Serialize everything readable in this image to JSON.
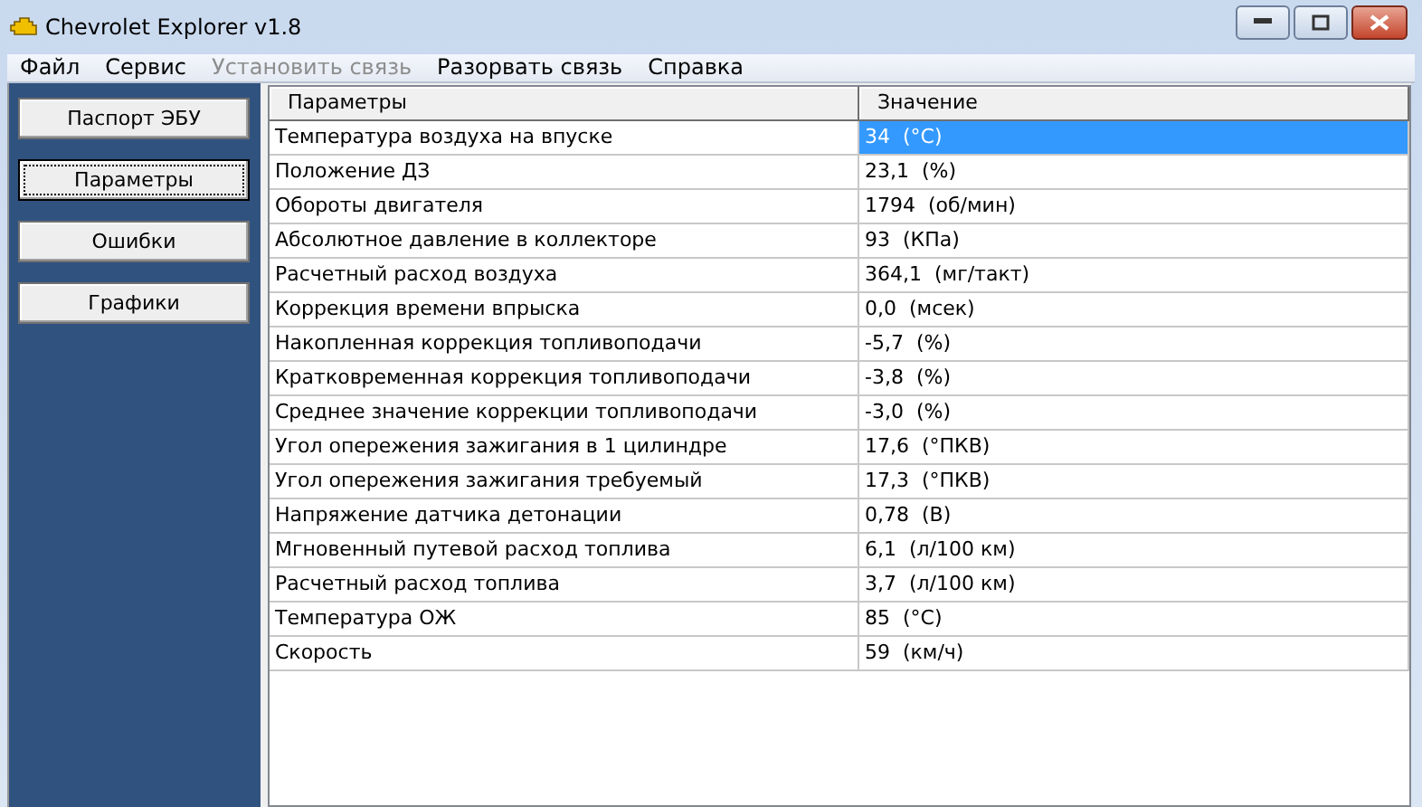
{
  "window": {
    "title": "Chevrolet Explorer v1.8"
  },
  "menu": [
    {
      "label": "Файл",
      "disabled": false
    },
    {
      "label": "Сервис",
      "disabled": false
    },
    {
      "label": "Установить связь",
      "disabled": true
    },
    {
      "label": "Разорвать связь",
      "disabled": false
    },
    {
      "label": "Справка",
      "disabled": false
    }
  ],
  "sidebar": {
    "buttons": [
      {
        "label": "Паспорт ЭБУ",
        "selected": false
      },
      {
        "label": "Параметры",
        "selected": true
      },
      {
        "label": "Ошибки",
        "selected": false
      },
      {
        "label": "Графики",
        "selected": false
      }
    ]
  },
  "table": {
    "columns": [
      "Параметры",
      "Значение"
    ],
    "rows": [
      {
        "name": "Температура воздуха на впуске",
        "value": "34  (°C)",
        "selected": true
      },
      {
        "name": "Положение ДЗ",
        "value": "23,1  (%)",
        "selected": false
      },
      {
        "name": "Обороты двигателя",
        "value": "1794  (об/мин)",
        "selected": false
      },
      {
        "name": "Абсолютное давление в коллекторе",
        "value": "93  (КПа)",
        "selected": false
      },
      {
        "name": "Расчетный расход воздуха",
        "value": "364,1  (мг/такт)",
        "selected": false
      },
      {
        "name": "Коррекция времени впрыска",
        "value": "0,0  (мсек)",
        "selected": false
      },
      {
        "name": "Накопленная коррекция топливоподачи",
        "value": "-5,7  (%)",
        "selected": false
      },
      {
        "name": "Кратковременная коррекция топливоподачи",
        "value": "-3,8  (%)",
        "selected": false
      },
      {
        "name": "Среднее значение коррекции топливоподачи",
        "value": "-3,0  (%)",
        "selected": false
      },
      {
        "name": "Угол опережения зажигания в 1 цилиндре",
        "value": "17,6  (°ПКВ)",
        "selected": false
      },
      {
        "name": "Угол опережения зажигания требуемый",
        "value": "17,3  (°ПКВ)",
        "selected": false
      },
      {
        "name": "Напряжение датчика детонации",
        "value": "0,78  (В)",
        "selected": false
      },
      {
        "name": "Мгновенный путевой расход топлива",
        "value": "6,1  (л/100 км)",
        "selected": false
      },
      {
        "name": "Расчетный расход топлива",
        "value": "3,7  (л/100 км)",
        "selected": false
      },
      {
        "name": "Температура ОЖ",
        "value": "85  (°C)",
        "selected": false
      },
      {
        "name": "Скорость",
        "value": "59  (км/ч)",
        "selected": false
      }
    ]
  }
}
